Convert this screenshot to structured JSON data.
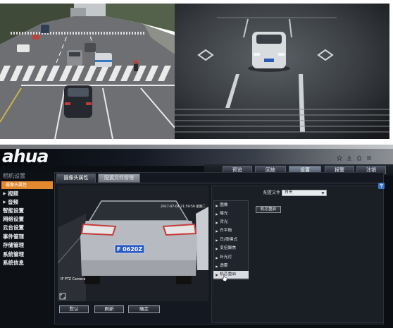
{
  "header": {
    "logo_text": "ahua",
    "browser_icons": [
      "star-icon",
      "download-icon",
      "home-icon",
      "menu-icon"
    ]
  },
  "nav": {
    "tabs": [
      {
        "label": "预览",
        "active": false
      },
      {
        "label": "回放",
        "active": false
      },
      {
        "label": "设置",
        "active": true
      },
      {
        "label": "报警",
        "active": false
      },
      {
        "label": "注销",
        "active": false
      }
    ]
  },
  "sidebar": {
    "title": "相机设置",
    "items": [
      {
        "label": "摄像头属性",
        "active": true
      },
      {
        "label": "视频",
        "active": false,
        "icon": "chevron-right-icon"
      },
      {
        "label": "音频",
        "active": false,
        "icon": "chevron-right-icon"
      },
      {
        "label": "智能设置",
        "active": false
      },
      {
        "label": "网络设置",
        "active": false
      },
      {
        "label": "云台设置",
        "active": false
      },
      {
        "label": "事件管理",
        "active": false
      },
      {
        "label": "存储管理",
        "active": false
      },
      {
        "label": "系统管理",
        "active": false
      },
      {
        "label": "系统信息",
        "active": false
      }
    ]
  },
  "main": {
    "tabs": [
      {
        "label": "摄像头属性",
        "active": true
      },
      {
        "label": "配置文件管理",
        "active": false
      }
    ]
  },
  "preview": {
    "osd_time": "2017-07-04 21:59:59 星期二",
    "osd_channel": "IP PTZ Camera",
    "plate_text": "F 0620Z",
    "fullscreen_icon": "fullscreen-icon"
  },
  "footer_buttons": {
    "default": "默认",
    "refresh": "刷新",
    "confirm": "确定"
  },
  "config": {
    "profile_label": "配置文件",
    "profile_value": "白天",
    "menu": [
      {
        "label": "图像",
        "active": false
      },
      {
        "label": "曝光",
        "active": false
      },
      {
        "label": "背光",
        "active": false
      },
      {
        "label": "白平衡",
        "active": false
      },
      {
        "label": "日/夜模式",
        "active": false
      },
      {
        "label": "变倍聚焦",
        "active": false
      },
      {
        "label": "补光灯",
        "active": false
      },
      {
        "label": "透雾",
        "active": false
      },
      {
        "label": "机芯重启",
        "active": true
      }
    ],
    "restart_button": "机芯重启"
  },
  "icons": {
    "help": "help-icon",
    "cursor": "hand-cursor-icon",
    "dropdown": "chevron-down-icon",
    "submenu": "chevron-right-icon"
  },
  "colors": {
    "accent": "#e2892f",
    "nav_active": "#7d8a9c",
    "plate": "#2a5bc4",
    "screen_bg": "#0b0e13"
  }
}
